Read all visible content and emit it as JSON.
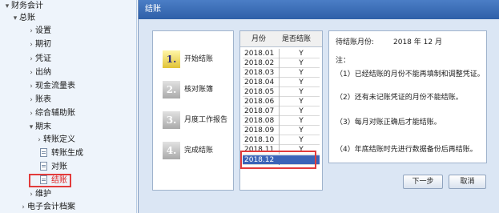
{
  "nav": {
    "items": [
      {
        "label": "财务会计",
        "level": 0,
        "expanded": true
      },
      {
        "label": "总账",
        "level": 1,
        "expanded": true
      },
      {
        "label": "设置",
        "level": 2
      },
      {
        "label": "期初",
        "level": 2
      },
      {
        "label": "凭证",
        "level": 2
      },
      {
        "label": "出纳",
        "level": 2
      },
      {
        "label": "现金流量表",
        "level": 2
      },
      {
        "label": "账表",
        "level": 2
      },
      {
        "label": "综合辅助账",
        "level": 2
      },
      {
        "label": "期末",
        "level": 2,
        "expanded": true
      },
      {
        "label": "转账定义",
        "level": 3
      },
      {
        "label": "转账生成",
        "level": 3
      },
      {
        "label": "对账",
        "level": 3
      },
      {
        "label": "结账",
        "level": 3,
        "selected": true
      },
      {
        "label": "维护",
        "level": 2
      },
      {
        "label": "电子会计档案",
        "level": 1
      }
    ]
  },
  "dialog": {
    "title": "结账",
    "steps": [
      {
        "num": "1.",
        "label": "开始结账",
        "active": true
      },
      {
        "num": "2.",
        "label": "核对账簿",
        "active": false
      },
      {
        "num": "3.",
        "label": "月度工作报告",
        "active": false
      },
      {
        "num": "4.",
        "label": "完成结账",
        "active": false
      }
    ],
    "table": {
      "header_month": "月份",
      "header_closed": "是否结账",
      "rows": [
        {
          "month": "2018.01",
          "closed": "Y"
        },
        {
          "month": "2018.02",
          "closed": "Y"
        },
        {
          "month": "2018.03",
          "closed": "Y"
        },
        {
          "month": "2018.04",
          "closed": "Y"
        },
        {
          "month": "2018.05",
          "closed": "Y"
        },
        {
          "month": "2018.06",
          "closed": "Y"
        },
        {
          "month": "2018.07",
          "closed": "Y"
        },
        {
          "month": "2018.08",
          "closed": "Y"
        },
        {
          "month": "2018.09",
          "closed": "Y"
        },
        {
          "month": "2018.10",
          "closed": "Y"
        },
        {
          "month": "2018.11",
          "closed": "Y"
        },
        {
          "month": "2018.12",
          "closed": "",
          "selected": true
        }
      ]
    },
    "info": {
      "pending_label": "待结账月份:",
      "pending_value": "2018 年 12 月",
      "note_title": "注：",
      "notes": [
        "（1）已经结账的月份不能再填制和调整凭证。",
        "（2）还有未记账凭证的月份不能结账。",
        "（3）每月对账正确后才能结账。",
        "（4）年底结账时先进行数据备份后再结账。"
      ]
    },
    "buttons": {
      "next": "下一步",
      "cancel": "取消"
    }
  },
  "colors": {
    "title_bar": "#2e5fa8",
    "selection": "#3b64b8",
    "highlight_border": "#e23b3b"
  }
}
